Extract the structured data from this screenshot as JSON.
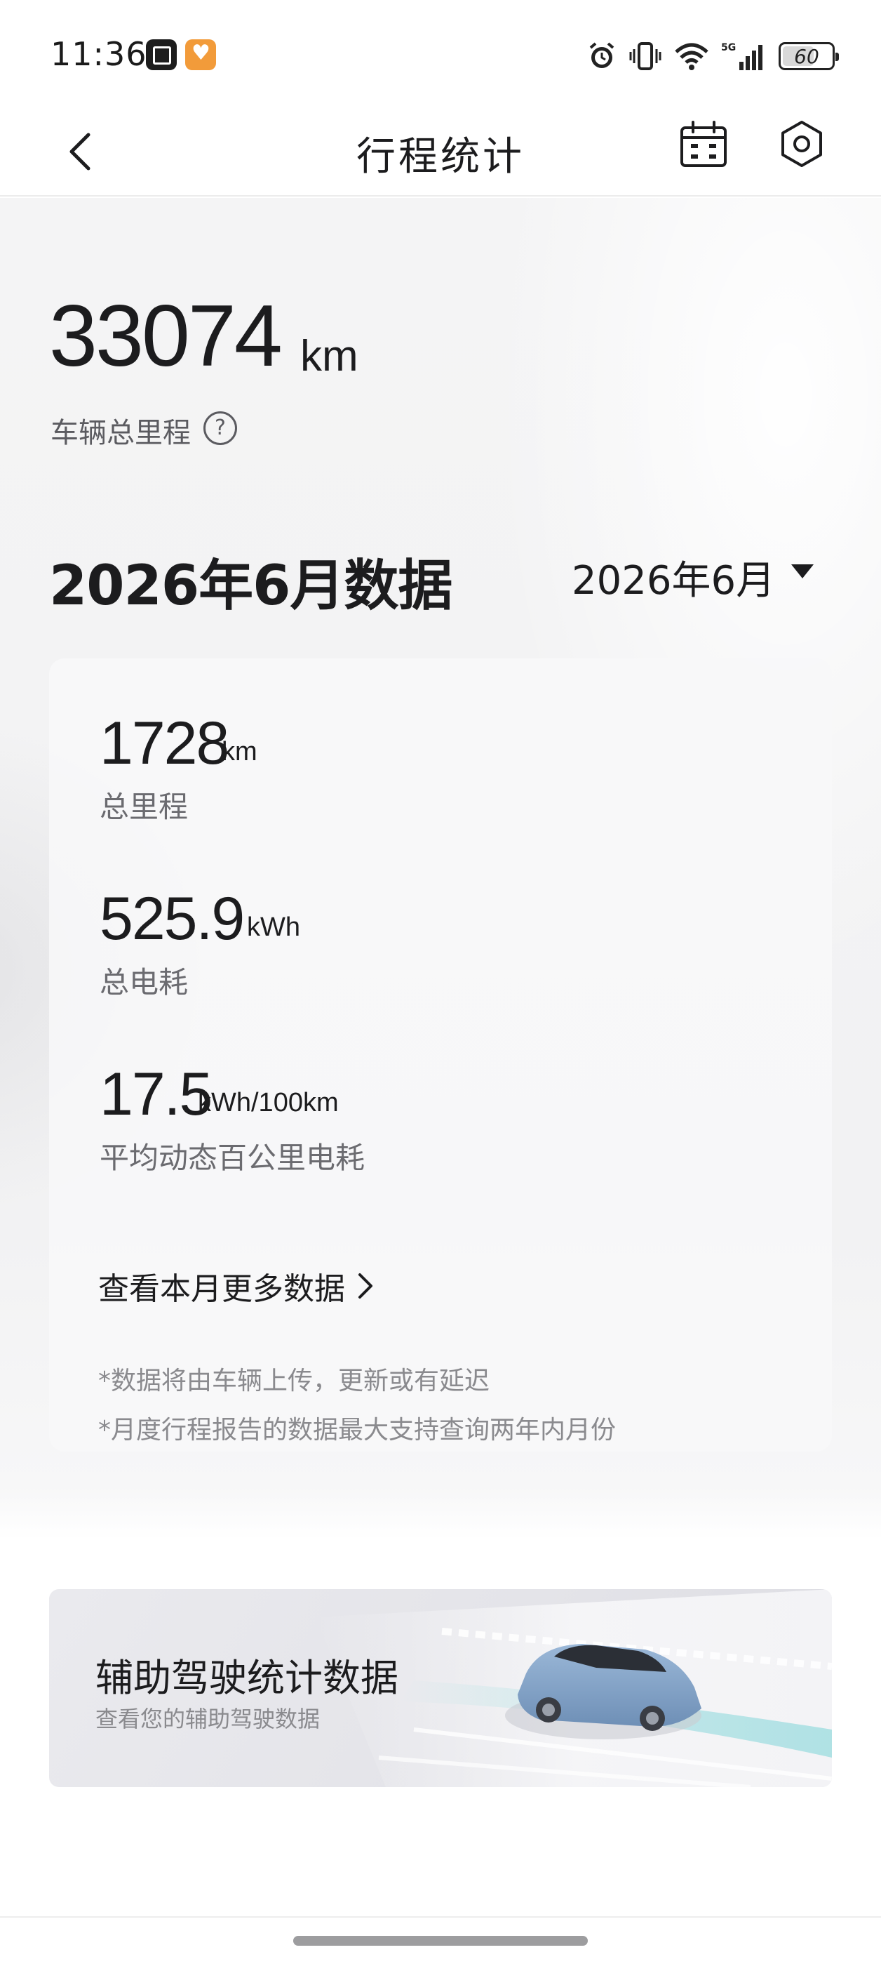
{
  "status_bar": {
    "time": "11:36",
    "battery": "60",
    "network": "5G"
  },
  "nav": {
    "title": "行程统计"
  },
  "total": {
    "value": "33074",
    "unit": "km",
    "label": "车辆总里程",
    "help_symbol": "?"
  },
  "month": {
    "title": "2026年6月数据",
    "selector": "2026年6月"
  },
  "metrics": [
    {
      "value": "1728",
      "unit": "km",
      "label": "总里程"
    },
    {
      "value": "525.9",
      "unit": "kWh",
      "label": "总电耗"
    },
    {
      "value": "17.5",
      "unit": "kWh/100km",
      "label": "平均动态百公里电耗"
    }
  ],
  "more_link": "查看本月更多数据",
  "notes": [
    "*数据将由车辆上传，更新或有延迟",
    "*月度行程报告的数据最大支持查询两年内月份"
  ],
  "adas": {
    "title": "辅助驾驶统计数据",
    "subtitle": "查看您的辅助驾驶数据"
  },
  "icons": {
    "back": "chevron-left-icon",
    "calendar": "calendar-icon",
    "settings": "hexagon-gear-icon",
    "help": "question-circle-icon",
    "dropdown": "caret-down-icon",
    "more": "chevron-right-icon"
  }
}
